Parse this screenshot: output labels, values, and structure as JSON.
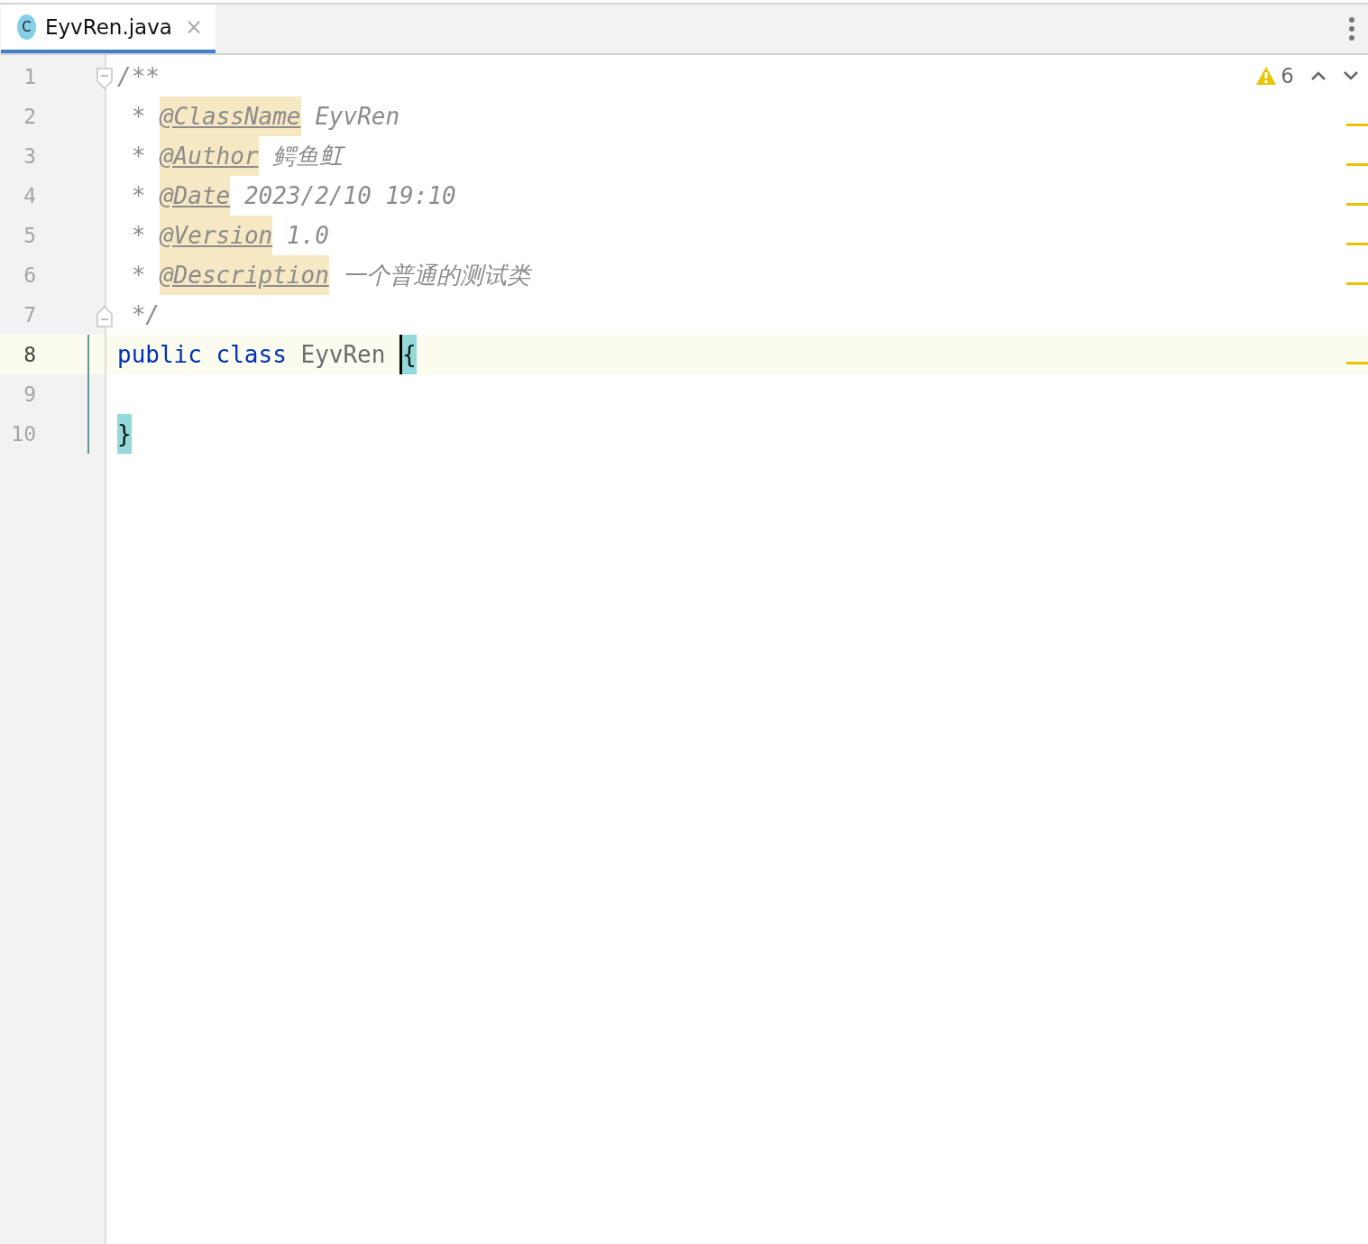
{
  "tabs": [
    {
      "label": "EyvRen.java",
      "icon": "C",
      "close": "×",
      "selected": true
    }
  ],
  "inspection": {
    "count": "6"
  },
  "lines": [
    {
      "number": "1",
      "current": false,
      "changed": false,
      "warning": false,
      "fold_marker": {
        "kind": "start"
      },
      "tokens": [
        {
          "kind": "comment",
          "text": "/**"
        }
      ]
    },
    {
      "number": "2",
      "current": false,
      "changed": false,
      "warning": true,
      "tokens": [
        {
          "kind": "comment",
          "text": " * "
        },
        {
          "kind": "tag",
          "text": "@ClassName"
        },
        {
          "kind": "comment",
          "text": " EyvRen"
        }
      ]
    },
    {
      "number": "3",
      "current": false,
      "changed": false,
      "warning": true,
      "tokens": [
        {
          "kind": "comment",
          "text": " * "
        },
        {
          "kind": "tag",
          "text": "@Author"
        },
        {
          "kind": "comment",
          "text": " 鳄鱼𫚉"
        }
      ]
    },
    {
      "number": "4",
      "current": false,
      "changed": false,
      "warning": true,
      "tokens": [
        {
          "kind": "comment",
          "text": " * "
        },
        {
          "kind": "tag",
          "text": "@Date"
        },
        {
          "kind": "comment",
          "text": " 2023/2/10 19:10"
        }
      ]
    },
    {
      "number": "5",
      "current": false,
      "changed": false,
      "warning": true,
      "tokens": [
        {
          "kind": "comment",
          "text": " * "
        },
        {
          "kind": "tag",
          "text": "@Version"
        },
        {
          "kind": "comment",
          "text": " 1.0"
        }
      ]
    },
    {
      "number": "6",
      "current": false,
      "changed": false,
      "warning": true,
      "tokens": [
        {
          "kind": "comment",
          "text": " * "
        },
        {
          "kind": "tag",
          "text": "@Description"
        },
        {
          "kind": "comment",
          "text": " 一个普通的测试类"
        }
      ]
    },
    {
      "number": "7",
      "current": false,
      "changed": false,
      "warning": false,
      "fold_marker": {
        "kind": "end"
      },
      "tokens": [
        {
          "kind": "comment",
          "text": " */"
        }
      ]
    },
    {
      "number": "8",
      "current": true,
      "changed": true,
      "warning": true,
      "tokens": [
        {
          "kind": "keyword",
          "text": "public"
        },
        {
          "kind": "keyword",
          "text": "class",
          "space": true
        },
        {
          "kind": "plain",
          "text": "EyvRen",
          "space": true
        },
        {
          "kind": "brace",
          "text": "{",
          "space": true,
          "caret": true
        }
      ]
    },
    {
      "number": "9",
      "current": false,
      "changed": true,
      "warning": false
    },
    {
      "number": "10",
      "current": false,
      "changed": true,
      "warning": false,
      "tokens": [
        {
          "kind": "brace",
          "text": "}",
          "caret": false
        }
      ]
    }
  ]
}
